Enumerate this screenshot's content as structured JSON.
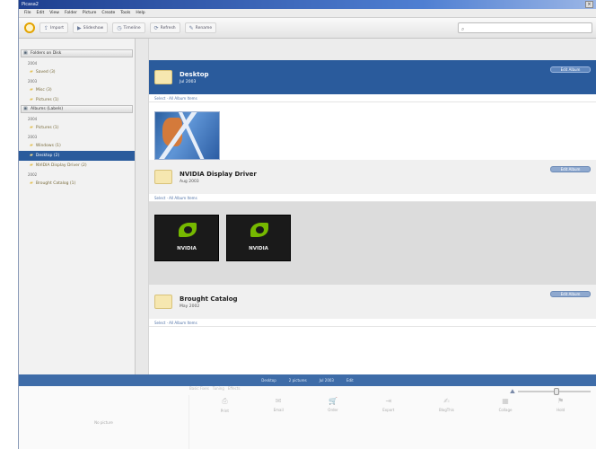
{
  "window": {
    "title": "Picasa2",
    "close_label": "×"
  },
  "menu": {
    "items": [
      "File",
      "Edit",
      "View",
      "Folder",
      "Picture",
      "Create",
      "Tools",
      "Help"
    ]
  },
  "toolbar": {
    "buttons": [
      {
        "icon": "import-icon",
        "label": "Import",
        "glyph": "⇪"
      },
      {
        "icon": "slideshow-icon",
        "label": "Slideshow",
        "glyph": "▶"
      },
      {
        "icon": "timeline-icon",
        "label": "Timeline",
        "glyph": "◷"
      },
      {
        "icon": "refresh-icon",
        "label": "Refresh",
        "glyph": "⟳"
      },
      {
        "icon": "rename-icon",
        "label": "Rename",
        "glyph": "✎"
      }
    ],
    "search_placeholder": "",
    "search_glyph": "⌕"
  },
  "sidebar": {
    "groups": [
      {
        "header": "Folders on Disk",
        "years": [
          {
            "year": "2004",
            "items": [
              {
                "label": "Saved (3)",
                "selected": false
              }
            ]
          },
          {
            "year": "2003",
            "items": [
              {
                "label": "Misc (3)",
                "selected": false
              },
              {
                "label": "Pictures (1)",
                "selected": false
              }
            ]
          }
        ]
      },
      {
        "header": "Albums (Labels)",
        "years": [
          {
            "year": "2004",
            "items": [
              {
                "label": "Pictures (1)",
                "selected": false
              }
            ]
          },
          {
            "year": "2003",
            "items": [
              {
                "label": "Windows (1)",
                "selected": false
              },
              {
                "label": "Desktop (2)",
                "selected": true
              },
              {
                "label": "NVIDIA Display Driver (2)",
                "selected": false
              }
            ]
          },
          {
            "year": "2002",
            "items": [
              {
                "label": "Brought Catalog (1)",
                "selected": false
              }
            ]
          }
        ]
      }
    ]
  },
  "albums": [
    {
      "title": "Desktop",
      "date": "Jul 2003",
      "action": "Edit Album",
      "links": "Select · All Album Items",
      "active": true,
      "thumb_style": "blue",
      "thumbs": [
        "desktop-wallpaper"
      ]
    },
    {
      "title": "NVIDIA Display Driver",
      "date": "Aug 2003",
      "action": "Edit Album",
      "links": "Select · All Album Items",
      "active": false,
      "thumb_style": "nvidia",
      "thumbs": [
        "nvidia-logo-1",
        "nvidia-logo-2"
      ]
    },
    {
      "title": "Brought Catalog",
      "date": "May 2002",
      "action": "Edit Album",
      "links": "Select · All Album Items",
      "active": false,
      "thumb_style": "none",
      "thumbs": []
    }
  ],
  "nvidia_label": "NVIDIA",
  "status": {
    "items": [
      "Desktop",
      "2 pictures",
      "Jul 2003",
      "Edit"
    ]
  },
  "bottom": {
    "preview_label": "No picture",
    "tabs": [
      "Basic Fixes",
      "Tuning",
      "Effects"
    ],
    "tools": [
      {
        "icon": "print-icon",
        "label": "Print",
        "glyph": "⎙"
      },
      {
        "icon": "email-icon",
        "label": "Email",
        "glyph": "✉"
      },
      {
        "icon": "order-icon",
        "label": "Order",
        "glyph": "🛒"
      },
      {
        "icon": "export-icon",
        "label": "Export",
        "glyph": "⇥"
      },
      {
        "icon": "blog-icon",
        "label": "BlogThis",
        "glyph": "✍"
      },
      {
        "icon": "collage-icon",
        "label": "Collage",
        "glyph": "▦"
      },
      {
        "icon": "hold-icon",
        "label": "Hold",
        "glyph": "⚑"
      }
    ],
    "zoom_glyph": "⛰",
    "zoom_level": 0.5
  },
  "colors": {
    "accent": "#2a5b9c",
    "status_bar": "#3e6ca8",
    "folder": "#f6e7b0"
  }
}
